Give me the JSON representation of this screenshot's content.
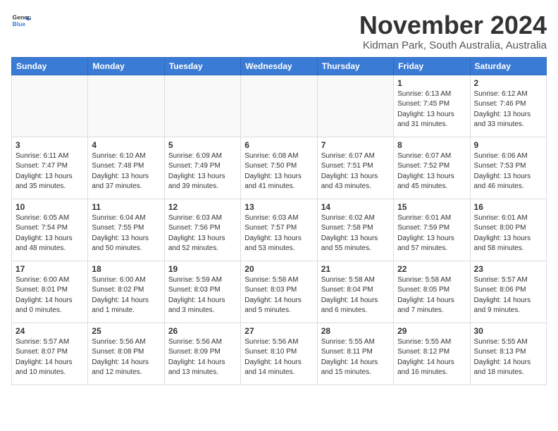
{
  "header": {
    "logo_line1": "General",
    "logo_line2": "Blue",
    "month": "November 2024",
    "location": "Kidman Park, South Australia, Australia"
  },
  "weekdays": [
    "Sunday",
    "Monday",
    "Tuesday",
    "Wednesday",
    "Thursday",
    "Friday",
    "Saturday"
  ],
  "weeks": [
    [
      {
        "day": "",
        "info": ""
      },
      {
        "day": "",
        "info": ""
      },
      {
        "day": "",
        "info": ""
      },
      {
        "day": "",
        "info": ""
      },
      {
        "day": "",
        "info": ""
      },
      {
        "day": "1",
        "info": "Sunrise: 6:13 AM\nSunset: 7:45 PM\nDaylight: 13 hours\nand 31 minutes."
      },
      {
        "day": "2",
        "info": "Sunrise: 6:12 AM\nSunset: 7:46 PM\nDaylight: 13 hours\nand 33 minutes."
      }
    ],
    [
      {
        "day": "3",
        "info": "Sunrise: 6:11 AM\nSunset: 7:47 PM\nDaylight: 13 hours\nand 35 minutes."
      },
      {
        "day": "4",
        "info": "Sunrise: 6:10 AM\nSunset: 7:48 PM\nDaylight: 13 hours\nand 37 minutes."
      },
      {
        "day": "5",
        "info": "Sunrise: 6:09 AM\nSunset: 7:49 PM\nDaylight: 13 hours\nand 39 minutes."
      },
      {
        "day": "6",
        "info": "Sunrise: 6:08 AM\nSunset: 7:50 PM\nDaylight: 13 hours\nand 41 minutes."
      },
      {
        "day": "7",
        "info": "Sunrise: 6:07 AM\nSunset: 7:51 PM\nDaylight: 13 hours\nand 43 minutes."
      },
      {
        "day": "8",
        "info": "Sunrise: 6:07 AM\nSunset: 7:52 PM\nDaylight: 13 hours\nand 45 minutes."
      },
      {
        "day": "9",
        "info": "Sunrise: 6:06 AM\nSunset: 7:53 PM\nDaylight: 13 hours\nand 46 minutes."
      }
    ],
    [
      {
        "day": "10",
        "info": "Sunrise: 6:05 AM\nSunset: 7:54 PM\nDaylight: 13 hours\nand 48 minutes."
      },
      {
        "day": "11",
        "info": "Sunrise: 6:04 AM\nSunset: 7:55 PM\nDaylight: 13 hours\nand 50 minutes."
      },
      {
        "day": "12",
        "info": "Sunrise: 6:03 AM\nSunset: 7:56 PM\nDaylight: 13 hours\nand 52 minutes."
      },
      {
        "day": "13",
        "info": "Sunrise: 6:03 AM\nSunset: 7:57 PM\nDaylight: 13 hours\nand 53 minutes."
      },
      {
        "day": "14",
        "info": "Sunrise: 6:02 AM\nSunset: 7:58 PM\nDaylight: 13 hours\nand 55 minutes."
      },
      {
        "day": "15",
        "info": "Sunrise: 6:01 AM\nSunset: 7:59 PM\nDaylight: 13 hours\nand 57 minutes."
      },
      {
        "day": "16",
        "info": "Sunrise: 6:01 AM\nSunset: 8:00 PM\nDaylight: 13 hours\nand 58 minutes."
      }
    ],
    [
      {
        "day": "17",
        "info": "Sunrise: 6:00 AM\nSunset: 8:01 PM\nDaylight: 14 hours\nand 0 minutes."
      },
      {
        "day": "18",
        "info": "Sunrise: 6:00 AM\nSunset: 8:02 PM\nDaylight: 14 hours\nand 1 minute."
      },
      {
        "day": "19",
        "info": "Sunrise: 5:59 AM\nSunset: 8:03 PM\nDaylight: 14 hours\nand 3 minutes."
      },
      {
        "day": "20",
        "info": "Sunrise: 5:58 AM\nSunset: 8:03 PM\nDaylight: 14 hours\nand 5 minutes."
      },
      {
        "day": "21",
        "info": "Sunrise: 5:58 AM\nSunset: 8:04 PM\nDaylight: 14 hours\nand 6 minutes."
      },
      {
        "day": "22",
        "info": "Sunrise: 5:58 AM\nSunset: 8:05 PM\nDaylight: 14 hours\nand 7 minutes."
      },
      {
        "day": "23",
        "info": "Sunrise: 5:57 AM\nSunset: 8:06 PM\nDaylight: 14 hours\nand 9 minutes."
      }
    ],
    [
      {
        "day": "24",
        "info": "Sunrise: 5:57 AM\nSunset: 8:07 PM\nDaylight: 14 hours\nand 10 minutes."
      },
      {
        "day": "25",
        "info": "Sunrise: 5:56 AM\nSunset: 8:08 PM\nDaylight: 14 hours\nand 12 minutes."
      },
      {
        "day": "26",
        "info": "Sunrise: 5:56 AM\nSunset: 8:09 PM\nDaylight: 14 hours\nand 13 minutes."
      },
      {
        "day": "27",
        "info": "Sunrise: 5:56 AM\nSunset: 8:10 PM\nDaylight: 14 hours\nand 14 minutes."
      },
      {
        "day": "28",
        "info": "Sunrise: 5:55 AM\nSunset: 8:11 PM\nDaylight: 14 hours\nand 15 minutes."
      },
      {
        "day": "29",
        "info": "Sunrise: 5:55 AM\nSunset: 8:12 PM\nDaylight: 14 hours\nand 16 minutes."
      },
      {
        "day": "30",
        "info": "Sunrise: 5:55 AM\nSunset: 8:13 PM\nDaylight: 14 hours\nand 18 minutes."
      }
    ]
  ]
}
